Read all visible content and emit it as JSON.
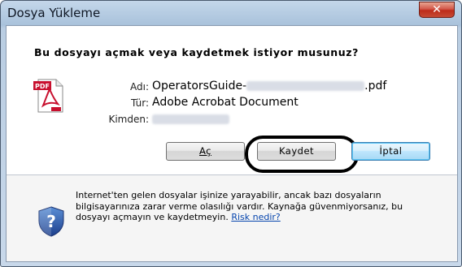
{
  "window": {
    "title": "Dosya Yükleme",
    "close_glyph": "✕"
  },
  "question": "Bu dosyayı açmak veya kaydetmek istiyor musunuz?",
  "file": {
    "name_label": "Adı:",
    "name_prefix": "OperatorsGuide-",
    "name_suffix": ".pdf",
    "type_label": "Tür:",
    "type_value": "Adobe Acrobat Document",
    "from_label": "Kimden:",
    "icon": "pdf-file-icon",
    "icon_badge": "PDF"
  },
  "buttons": {
    "open": "Aç",
    "save": "Kaydet",
    "cancel": "İptal"
  },
  "info": {
    "line1": "Internet'ten gelen dosyalar işinize yarayabilir, ancak bazı dosyaların",
    "line2": "bilgisayarınıza zarar verme olasılığı vardır. Kaynağa güvenmiyorsanız, bu",
    "line3_prefix": "dosyayı açmayın ve kaydetmeyin.",
    "link": "Risk nedir?",
    "icon": "security-shield-question-icon"
  },
  "colors": {
    "link": "#0645ad",
    "highlight_ring": "#000000",
    "close_button": "#c64a34"
  }
}
